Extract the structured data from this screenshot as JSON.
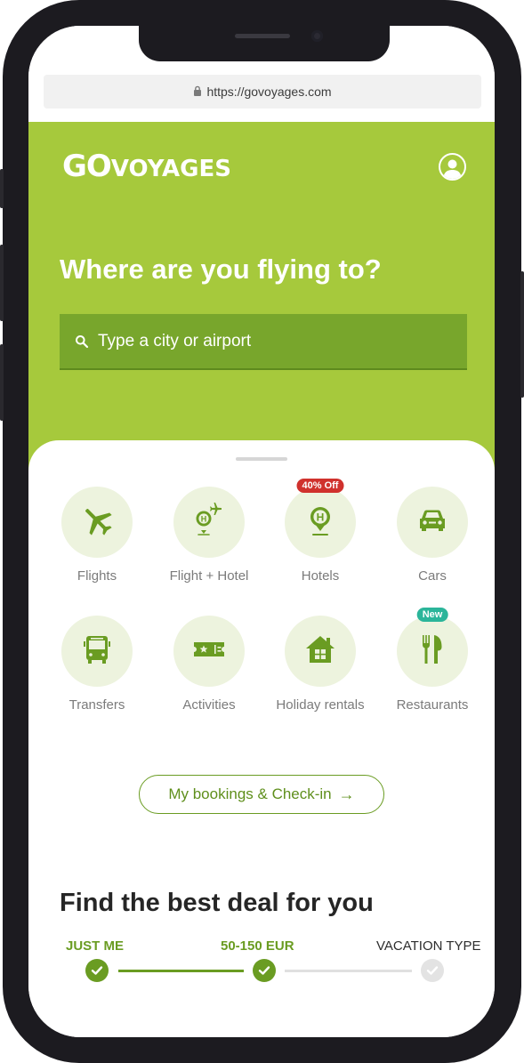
{
  "browser": {
    "url": "https://govoyages.com"
  },
  "brand": {
    "logo_big": "GO",
    "logo_small": "VOYAGES",
    "accent": "#a6c93c",
    "accent_dark": "#6a9c22"
  },
  "hero": {
    "title": "Where are you flying to?",
    "search_placeholder": "Type a city or airport"
  },
  "categories": [
    {
      "label": "Flights",
      "icon": "airplane-icon"
    },
    {
      "label": "Flight + Hotel",
      "icon": "flight-hotel-icon"
    },
    {
      "label": "Hotels",
      "icon": "hotel-pin-icon",
      "badge": "40% Off",
      "badge_color": "#d0312d"
    },
    {
      "label": "Cars",
      "icon": "car-icon"
    },
    {
      "label": "Transfers",
      "icon": "bus-icon"
    },
    {
      "label": "Activities",
      "icon": "ticket-icon"
    },
    {
      "label": "Holiday rentals",
      "icon": "house-icon"
    },
    {
      "label": "Restaurants",
      "icon": "cutlery-icon",
      "badge": "New",
      "badge_color": "#2bb59a"
    }
  ],
  "bookings_button": {
    "label": "My bookings & Check-in",
    "arrow": "→"
  },
  "deals": {
    "title": "Find the best deal for you",
    "steps": [
      {
        "label": "JUST ME",
        "state": "done"
      },
      {
        "label": "50-150 EUR",
        "state": "done"
      },
      {
        "label": "VACATION TYPE",
        "state": "pending"
      }
    ]
  }
}
